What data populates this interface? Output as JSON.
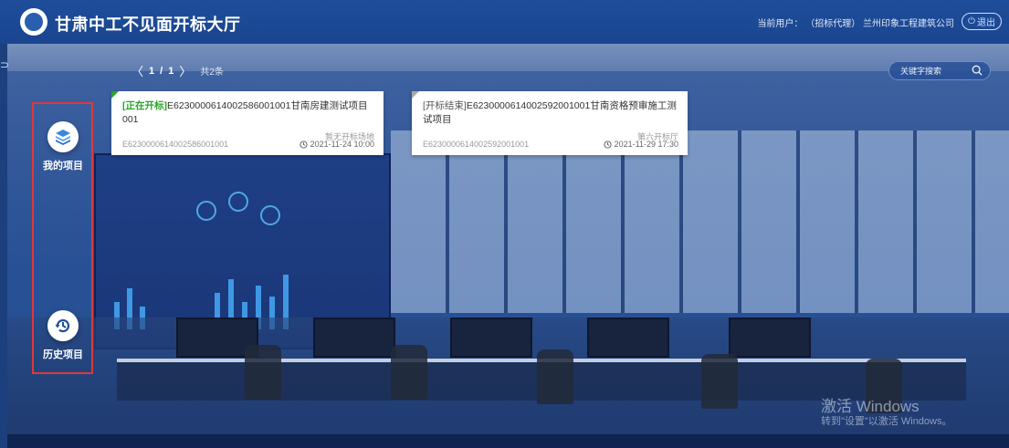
{
  "header": {
    "title": "甘肃中工不见面开标大厅",
    "user_label": "当前用户：",
    "user_role": "（招标代理）",
    "user_company": "兰州印象工程建筑公司",
    "logout_label": "退出"
  },
  "pager": {
    "prev": "〈",
    "current": "1",
    "separator": "/",
    "total_pages": "1",
    "next": "〉",
    "total_text": "共2条"
  },
  "search": {
    "placeholder": "关键字搜索",
    "value": ""
  },
  "sidebar": {
    "items": [
      {
        "label": "我的项目",
        "icon": "layers-icon"
      },
      {
        "label": "历史项目",
        "icon": "history-icon"
      }
    ]
  },
  "cards": [
    {
      "status": "[正在开标]",
      "title": "E6230000614002586001001甘南房建测试项目001",
      "room": "暂无开标场地",
      "code": "E6230000614002586001001",
      "time": "2021-11-24 10:00"
    },
    {
      "status": "[开标结束]",
      "title": "E6230000614002592001001甘南资格预审施工测试项目",
      "room": "第六开标厅",
      "code": "E6230000614002592001001",
      "time": "2021-11-29 17:30"
    }
  ],
  "watermark": {
    "title": "激活 Windows",
    "subtitle": "转到\"设置\"以激活 Windows。"
  },
  "colors": {
    "header_bg": "#1e4d9a",
    "active_status": "#2aa52a",
    "ended_corner": "#a9a9a9",
    "highlight_frame": "#e03838"
  }
}
